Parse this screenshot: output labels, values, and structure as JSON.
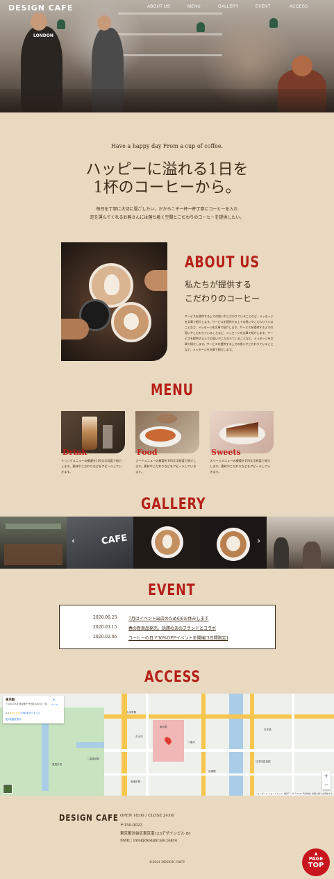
{
  "header": {
    "logo": "DESIGN CAFE",
    "nav": [
      "ABOUT US",
      "MENU",
      "GALLERY",
      "EVENT",
      "ACCESS"
    ]
  },
  "hero": {
    "sign_text": "LONDON"
  },
  "intro": {
    "tagline": "Have a happy day From a cup of coffee.",
    "headline_line1": "ハッピーに溢れる1日を",
    "headline_line2": "1杯のコーヒーから。",
    "lead_line1": "毎日を丁寧に大切に過ごしたい。だからこそ一杯一杯丁寧にコーヒーを入れ",
    "lead_line2": "足を運んでくれるお客さんには落ち着く空間とこだわりのコーヒーを提供したい。"
  },
  "about": {
    "title": "ABOUT US",
    "sub_line1": "私たちが提供する",
    "sub_line2": "こだわりのコーヒー",
    "body": "サービスを提供する上での思いやこだわりていることなど、メッセージを文章で紹介します。サービスを提供する上での思いやこだわりていることなど、メッセージを文章で紹介します。サービスを提供する上での思いやこだわりていることなど、メッセージを文章で紹介します。サービスを提供する上での思いやこだわりていることなど、メッセージを文章で紹介します。サービスを提供する上での思いやこだわりていることなど、メッセージを文章で紹介します。"
  },
  "menu": {
    "title": "MENU",
    "items": [
      {
        "name": "Drink",
        "desc": "ドリンクメニューの概要を100文字程度で紹介します。素材やこだわりなどをアピールしていきます。"
      },
      {
        "name": "Food",
        "desc": "フードメニューの概要を100文字程度で紹介します。素材やこだわりなどをアピールしていきます。"
      },
      {
        "name": "Sweets",
        "desc": "スイーツメニューの概要を100文字程度で紹介します。素材やこだわりなどをアピールしていきます。"
      }
    ]
  },
  "gallery": {
    "title": "GALLERY",
    "prev": "‹",
    "next": "›",
    "sign_text": "CAFE"
  },
  "event": {
    "title": "EVENT",
    "items": [
      {
        "date": "2020.06.23",
        "text": "7月はイベント出店のため6/8お休みします"
      },
      {
        "date": "2020.03.15",
        "text": "春の新商品発売。話題のあのブランドとコラボ"
      },
      {
        "date": "2020.02.06",
        "text": "コーヒーの日で30%OFFイベントを開催[3日間限定]"
      }
    ]
  },
  "access": {
    "title": "ACCESS",
    "map_card": {
      "place": "東京駅",
      "address": "〒100-0005 東京都千代田区丸の内1丁目",
      "rating": "4.3",
      "reviews": "9,662件のクチコミ",
      "route": "ルート",
      "larger_map": "拡大地図を表示"
    },
    "map_labels": [
      "大手町駅",
      "東京駅",
      "日本橋",
      "京橋駅",
      "有楽町駅",
      "二重橋前駅",
      "皇居外苑",
      "丸の内",
      "八重洲",
      "日本橋高島屋"
    ],
    "map_footer": "キーボード ショートカット  地図データ ©2020  利用規約  地図の誤りを報告する"
  },
  "footer": {
    "logo": "DESIGN CAFE",
    "hours": "OPEN 18:00 / CLOSE 24:00",
    "zip": "〒150-0022",
    "address": "東京都渋谷区東京南123デザインビル B1",
    "mail": "MAIL: info@designcafe.tokyo",
    "copyright": "©2021 DESIGN CAFE",
    "pagetop_line1": "PAGE",
    "pagetop_line2": "TOP"
  },
  "colors": {
    "accent": "#b52018",
    "background": "#e8d9c0",
    "text": "#3a2a1a"
  }
}
